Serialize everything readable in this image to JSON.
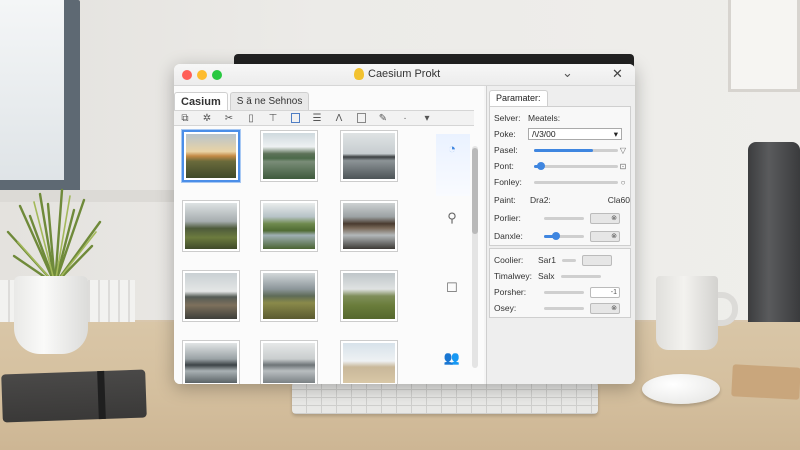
{
  "window": {
    "title": "Caesium Prokt",
    "minimize_glyph": "⌄",
    "close_glyph": "✕"
  },
  "left_panel": {
    "tabs": [
      {
        "label": "Casium",
        "active": true
      },
      {
        "label": "S ä ne Sehnos",
        "active": false
      }
    ],
    "toolbar_icons": [
      "crop-icon",
      "sparkle-icon",
      "scissors-icon",
      "page-icon",
      "filter-icon",
      "frame-icon",
      "list-icon",
      "text-icon",
      "rect-icon",
      "brush-icon",
      "more-icon",
      "chevron-down-icon"
    ],
    "thumbnails": [
      {
        "name": "sunset-valley",
        "selected": true
      },
      {
        "name": "mountain-lake",
        "selected": false
      },
      {
        "name": "misty-rock",
        "selected": false
      },
      {
        "name": "tree-road",
        "selected": false
      },
      {
        "name": "river-hills",
        "selected": false
      },
      {
        "name": "rocky-river",
        "selected": false
      },
      {
        "name": "lone-road",
        "selected": false
      },
      {
        "name": "mountain-meadow",
        "selected": false
      },
      {
        "name": "green-hills",
        "selected": false
      },
      {
        "name": "cliff-lake",
        "selected": false
      },
      {
        "name": "calm-water",
        "selected": false
      },
      {
        "name": "beach-walker",
        "selected": false
      }
    ],
    "side_icons": [
      "drop-icon",
      "search-icon",
      "square-icon",
      "people-icon"
    ]
  },
  "parameters": {
    "tab_label": "Paramater:",
    "rows": [
      {
        "label": "Selver:",
        "value": "Meatels:"
      },
      {
        "label": "Poke:",
        "value": "/\\/3/00",
        "type": "select"
      },
      {
        "label": "Pasel:",
        "level": 0.7,
        "icon": "▽"
      },
      {
        "label": "Pont:",
        "level": 0.08,
        "icon": "⊡"
      },
      {
        "label": "Fonley:",
        "level": 0.0,
        "icon": "○"
      },
      {
        "label": "Paint:",
        "value": "Dra2:",
        "value2": "Cla60"
      },
      {
        "label": "Porlier:",
        "level": 0.0,
        "icon": "⊗"
      },
      {
        "label": "Danxle:",
        "level": 0.3,
        "icon": "⊗"
      }
    ],
    "rows2": [
      {
        "label": "Coolier:",
        "value": "Sar1"
      },
      {
        "label": "Timalwey:",
        "value": "Salx"
      },
      {
        "label": "Porsher:",
        "field": "-1"
      },
      {
        "label": "Osey:",
        "icon": "⊗"
      }
    ]
  },
  "colors": {
    "accent": "#3f86e0",
    "selection": "#4b8ee8"
  }
}
